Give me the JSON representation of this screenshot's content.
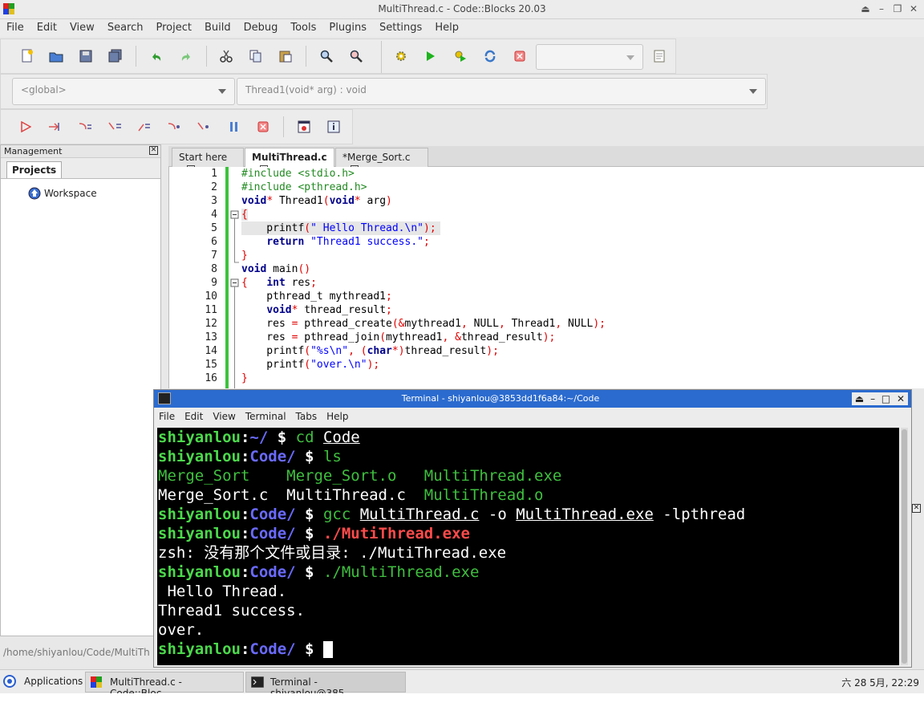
{
  "window": {
    "title": "MultiThread.c - Code::Blocks 20.03"
  },
  "menubar": [
    "File",
    "Edit",
    "View",
    "Search",
    "Project",
    "Build",
    "Debug",
    "Tools",
    "Plugins",
    "Settings",
    "Help"
  ],
  "toolbar": {
    "scope_combo": "<global>",
    "function_combo": "Thread1(void* arg) : void"
  },
  "management": {
    "header": "Management",
    "tab": "Projects",
    "tree_root": "Workspace"
  },
  "editor": {
    "tabs": [
      {
        "label": "Start here"
      },
      {
        "label": "MultiThread.c"
      },
      {
        "label": "*Merge_Sort.c"
      }
    ],
    "line_numbers": [
      "1",
      "2",
      "3",
      "4",
      "5",
      "6",
      "7",
      "8",
      "9",
      "10",
      "11",
      "12",
      "13",
      "14",
      "15",
      "16"
    ]
  },
  "terminal": {
    "title": "Terminal - shiyanlou@3853dd1f6a84:~/Code",
    "menu": [
      "File",
      "Edit",
      "View",
      "Terminal",
      "Tabs",
      "Help"
    ],
    "prompt_user": "shiyanlou",
    "prompt_dir_home": "~/",
    "prompt_dir_code": "Code/",
    "cmd_cd": "cd",
    "cmd_cd_arg": "Code",
    "cmd_ls": "ls",
    "ls_row1": [
      "Merge_Sort",
      "Merge_Sort.o",
      "MultiThread.exe"
    ],
    "ls_row2": [
      "Merge_Sort.c",
      "MultiThread.c",
      "MultiThread.o"
    ],
    "cmd_gcc": "gcc",
    "gcc_src": "MultiThread.c",
    "gcc_opt": "-o",
    "gcc_out": "MultiThread.exe",
    "gcc_lib": "-lpthread",
    "cmd_run_bad": "./MutiThread.exe",
    "error_line": "zsh: 没有那个文件或目录: ./MutiThread.exe",
    "cmd_run_ok": "./MultiThread.exe",
    "out1": " Hello Thread.",
    "out2": "Thread1 success.",
    "out3": "over."
  },
  "status_path": "/home/shiyanlou/Code/MultiTh",
  "taskbar": {
    "applications": "Applications",
    "task1": "MultiThread.c - Code::Bloc…",
    "task2": "Terminal - shiyanlou@385…",
    "clock": "六 28 5月, 22:29"
  }
}
